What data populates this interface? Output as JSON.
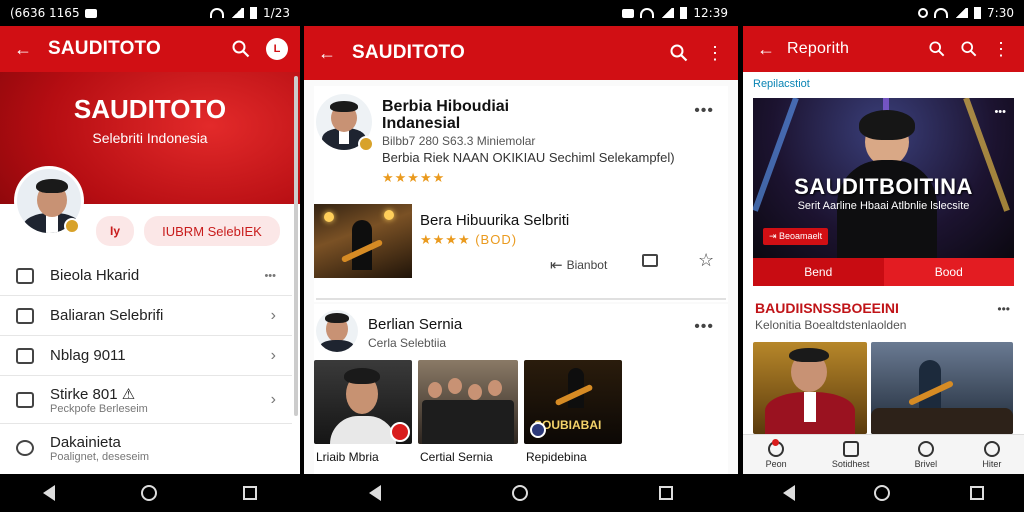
{
  "phone1": {
    "status": {
      "left_text": "(6636 1165",
      "time": "1/23"
    },
    "appbar": {
      "title": "SAUDITOTO",
      "avatar_text": "L"
    },
    "hero": {
      "brand": "SAUDITOTO",
      "subtitle": "Selebriti Indonesia"
    },
    "pill_small": "Iy",
    "pill_wide": "IUBRM SelebIEK",
    "menu": [
      {
        "label": "Bieola Hkarid",
        "sub": "",
        "trail": ""
      },
      {
        "label": "Baliaran Selebrifi",
        "sub": "",
        "trail": "›"
      },
      {
        "label": "Nblag 9011",
        "sub": "",
        "trail": "›"
      },
      {
        "label": "Stirke 801 ⚠",
        "sub": "Peckpofe Berleseim",
        "trail": "›"
      },
      {
        "label": "Dakainieta",
        "sub": "Poalignet, deseseim",
        "trail": ""
      }
    ]
  },
  "phone2": {
    "status": {
      "time": "12:39"
    },
    "appbar": {
      "title": "SAUDITOTO"
    },
    "post1": {
      "title_line1": "Berbia Hiboudiai",
      "title_line2": "Indanesial",
      "meta": "Bilbb7 280  S63.3 Miniemolar",
      "desc": "Berbia Riek NAAN OKIKIAU Sechiml Selekampfel)",
      "rating_stars": "★★★★★"
    },
    "post2": {
      "title": "Bera Hibuurika Selbriti",
      "rating": "★★★★ (BOD)",
      "action_share": "Bianbot",
      "rating_value": 4
    },
    "post3": {
      "title": "Berlian Sernia",
      "sub": "Cerla Selebtiia",
      "thumbs": [
        "Lriaib Mbria",
        "Certial Sernia",
        "Repidebina"
      ],
      "thumb3_text": "SOUBIABAI"
    }
  },
  "phone3": {
    "status": {
      "time": "7:30"
    },
    "appbar": {
      "title": "Reporith"
    },
    "section_label": "Repilacstiot",
    "hero": {
      "title": "SAUDITBOITINA",
      "subtitle": "Serit Aarline Hbaai   Atlbnlie lslecsite",
      "chip": "⇥ Beoamaelt"
    },
    "tabs": [
      "Bend",
      "Bood"
    ],
    "section2": {
      "title": "BAUDIISNSSBOEEINI",
      "sub": "Kelonitia Boealtdstenlaolden"
    },
    "bottom_nav": [
      "Peon",
      "Sotidhest",
      "Brivel",
      "Hiter"
    ]
  },
  "colors": {
    "accent": "#d10f14",
    "star": "#ea9a1e"
  }
}
